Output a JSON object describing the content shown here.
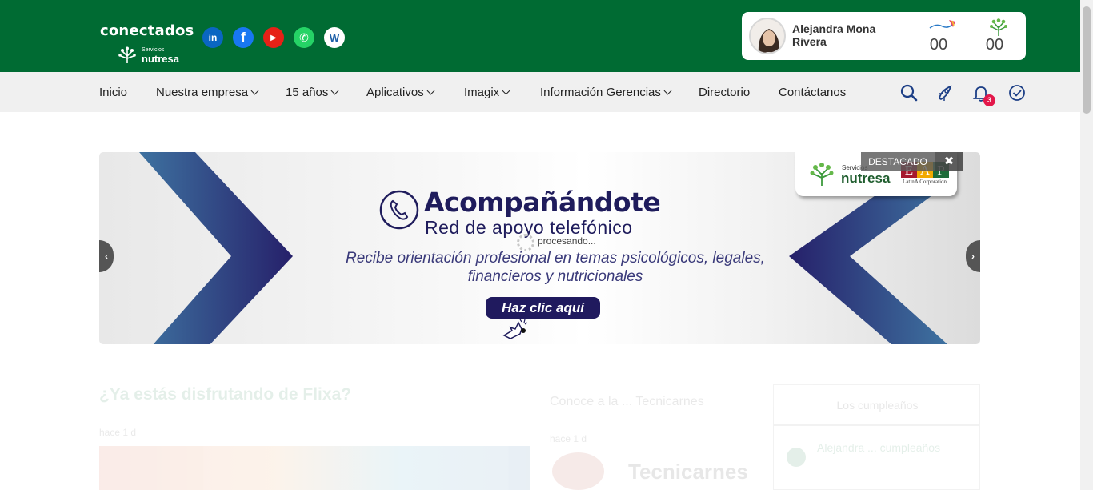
{
  "header": {
    "brand_name": "conectados",
    "brand_sub_small": "Servicios",
    "brand_sub": "nutresa",
    "social": [
      {
        "name": "linkedin",
        "glyph": "in"
      },
      {
        "name": "facebook",
        "glyph": "f"
      },
      {
        "name": "youtube",
        "glyph": "▶"
      },
      {
        "name": "whatsapp",
        "glyph": "✆"
      },
      {
        "name": "other",
        "glyph": "W"
      }
    ],
    "profile": {
      "name": "Alejandra Mona Rivera",
      "stat_kite_value": "00",
      "stat_tree_value": "00"
    }
  },
  "nav": {
    "items": [
      {
        "label": "Inicio",
        "dropdown": false
      },
      {
        "label": "Nuestra empresa",
        "dropdown": true
      },
      {
        "label": "15 años",
        "dropdown": true
      },
      {
        "label": "Aplicativos",
        "dropdown": true
      },
      {
        "label": "Imagix",
        "dropdown": true
      },
      {
        "label": "Información Gerencias",
        "dropdown": true
      },
      {
        "label": "Directorio",
        "dropdown": false
      },
      {
        "label": "Contáctanos",
        "dropdown": false
      }
    ],
    "icons": [
      "search-icon",
      "rocket-icon",
      "bell-icon",
      "check-circle-icon"
    ],
    "notification_count": "3"
  },
  "banner": {
    "title": "Acompañándote",
    "subtitle": "Red de apoyo telefónico",
    "description": "Recibe orientación profesional en temas psicológicos, legales, financieros y nutricionales",
    "cta": "Haz clic aquí",
    "processing_text": "procesando...",
    "prev": "‹",
    "next": "›",
    "featured_label": "DESTACADO",
    "close_glyph": "✖",
    "logo_small": "Servicios",
    "logo_big": "nutresa",
    "eap_letters": [
      "E",
      "A",
      "P"
    ],
    "eap_corp": "LatinA Corporation",
    "colors": {
      "navy": "#1f1c5c",
      "brand_green": "#006b33"
    }
  },
  "below": {
    "section_title": "¿Ya estás disfrutando de Flixa?",
    "section_small": "hace 1 d",
    "mid_title": "Conoce a la ... Tecnicarnes",
    "mid_small": "hace 1 d",
    "mid_brand": "Tecnicarnes",
    "side_title": "Los cumpleaños",
    "side_item": "Alejandra ... cumpleaños"
  }
}
